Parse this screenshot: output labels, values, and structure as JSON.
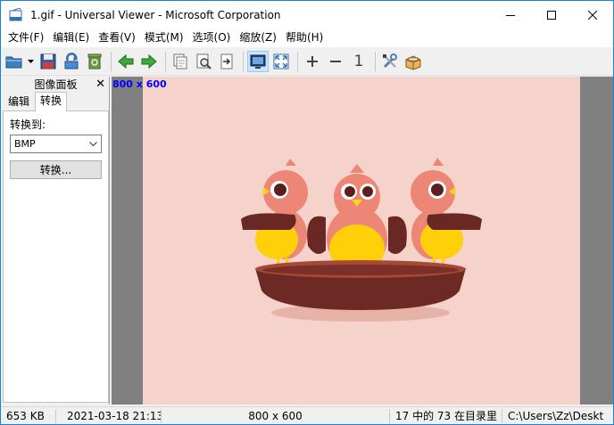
{
  "window": {
    "title": "1.gif - Universal Viewer - Microsoft Corporation"
  },
  "menu": [
    "文件(F)",
    "编辑(E)",
    "查看(V)",
    "模式(M)",
    "选项(O)",
    "缩放(Z)",
    "帮助(H)"
  ],
  "toolbar": {
    "zoom_reset_label": "1"
  },
  "panel": {
    "title": "图像面板",
    "close_symbol": "✕",
    "tabs": [
      "编辑",
      "转换"
    ],
    "convert_to_label": "转换到:",
    "format_selected": "BMP",
    "convert_button": "转换..."
  },
  "viewer": {
    "image_size_label": "800 x 600"
  },
  "status": {
    "file_size": "653 KB",
    "date": "2021-03-18 21:13",
    "dimensions": "800 x 600",
    "position": "17 中的 73 在目录里",
    "path": "C:\\Users\\Zz\\Deskt"
  },
  "colors": {
    "image_background": "#f6d3ca",
    "viewport_background": "#808080",
    "size_label": "#0000ff",
    "accent": "#1883d7"
  }
}
